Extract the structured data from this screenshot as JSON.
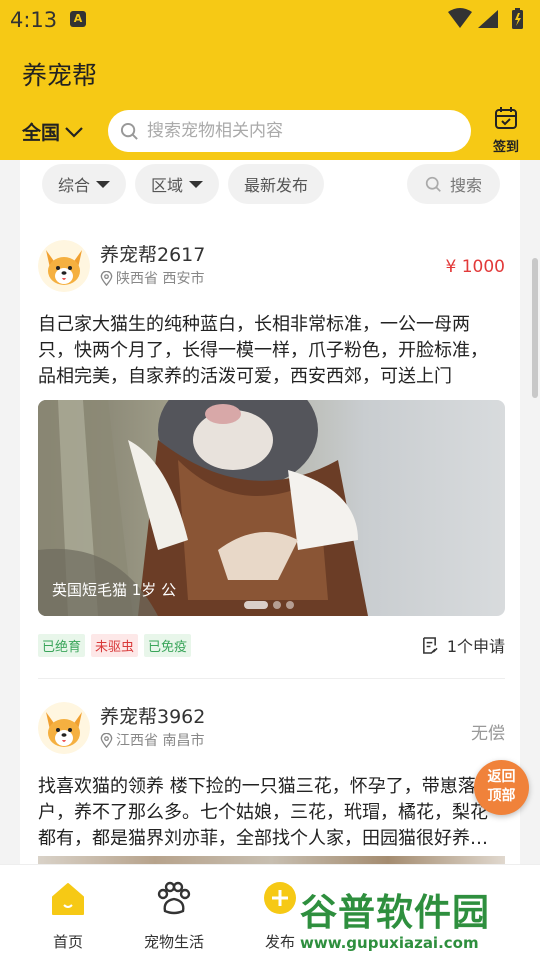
{
  "status_bar": {
    "time": "4:13",
    "notification_glyph": "A"
  },
  "header": {
    "app_title": "养宠帮",
    "region_label": "全国",
    "search_placeholder": "搜索宠物相关内容",
    "checkin_label": "签到"
  },
  "filters": {
    "items": [
      {
        "label": "综合",
        "has_dropdown": true
      },
      {
        "label": "区域",
        "has_dropdown": true
      },
      {
        "label": "最新发布",
        "has_dropdown": false
      }
    ],
    "search_label": "搜索"
  },
  "posts": [
    {
      "user": "养宠帮2617",
      "location": "陕西省 西安市",
      "price": "¥ 1000",
      "text": "自己家大猫生的纯种蓝白，长相非常标准，一公一母两只，快两个月了，长得一模一样，爪子粉色，开脸标准，品相完美，自家养的活泼可爱，西安西郊，可送上门",
      "photo_caption": "英国短毛猫  1岁  公",
      "tags": [
        {
          "label": "已绝育",
          "color": "green"
        },
        {
          "label": "未驱虫",
          "color": "red"
        },
        {
          "label": "已免疫",
          "color": "green"
        }
      ],
      "apply_count": "1个申请"
    },
    {
      "user": "养宠帮3962",
      "location": "江西省 南昌市",
      "price": "无偿",
      "text": "找喜欢猫的领养 楼下捡的一只猫三花，怀孕了，带崽落户，养不了那么多。七个姑娘，三花，玳瑁，橘花，梨花都有，都是猫界刘亦菲，全部找个人家，田园猫很好养…"
    }
  ],
  "back_to_top": {
    "line1": "返回",
    "line2": "顶部"
  },
  "tabbar": {
    "items": [
      {
        "label": "首页",
        "icon": "home-icon"
      },
      {
        "label": "宠物生活",
        "icon": "paw-icon"
      },
      {
        "label": "发布",
        "icon": "plus-icon"
      }
    ]
  },
  "watermark": {
    "big": "谷普软件园",
    "small": "www.gupuxiazai.com"
  },
  "colors": {
    "brand_yellow": "#f6c915",
    "price_red": "#e23a3a",
    "back_top_orange": "#f0823a"
  }
}
